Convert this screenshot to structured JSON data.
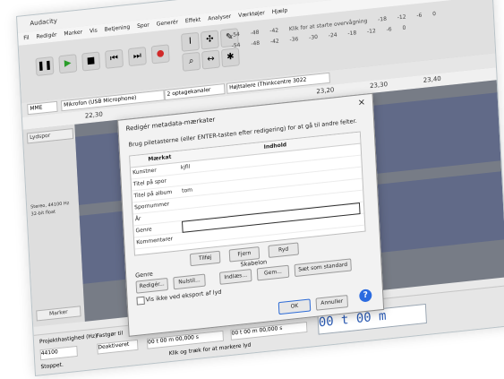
{
  "app": {
    "window_title": "Audacity",
    "menu": [
      "Fil",
      "Redigér",
      "Marker",
      "Vis",
      "Betjening",
      "Spor",
      "Generér",
      "Effekt",
      "Analyser",
      "Værktøjer",
      "Hjælp"
    ],
    "device_bar": {
      "host": "MME",
      "mic": "Mikrofon (USB Microphone)",
      "channels": "2 optagekanaler",
      "speaker": "Højttalere (Thinkcentre 3022"
    },
    "meters": {
      "click_text": "Klik for at starte overvågning",
      "levels": [
        "-54",
        "-48",
        "-42",
        "-18",
        "-12",
        "-6",
        "0"
      ],
      "levels2": [
        "-54",
        "-48",
        "-42",
        "-36",
        "-30",
        "-24",
        "-18",
        "-12",
        "-6",
        "0"
      ]
    },
    "ruler_ticks": [
      "22,30",
      "23,20",
      "23,30",
      "23,40"
    ],
    "track": {
      "label": "Lydspor",
      "info_line1": "Stereo, 44100 Hz",
      "info_line2": "32-bit float",
      "select_label": "Marker"
    },
    "status": {
      "project_rate_label": "Projekthastighed (Hz)",
      "project_rate_value": "44100",
      "snap_label": "Fastgør til",
      "snap_value": "Deaktiveret",
      "selection_label": "Begyndelse og slutning af markering",
      "time1": "00 t 00 m 00,000 s",
      "time2": "00 t 00 m 00,000 s",
      "stopped": "Stoppet.",
      "hint": "Klik og træk for at markere lyd",
      "audio_position": "00 t 00 m"
    }
  },
  "dialog": {
    "title": "Redigér metadata-mærkater",
    "close_label": "×",
    "instruction": "Brug piletasterne (eller ENTER-tasten efter redigering) for at gå til andre felter.",
    "columns": [
      "Mærkat",
      "Indhold"
    ],
    "rows": [
      {
        "tag": "Kunstner",
        "value": "kjfil"
      },
      {
        "tag": "Titel på spor",
        "value": ""
      },
      {
        "tag": "Titel på album",
        "value": "tom"
      },
      {
        "tag": "Spornummer",
        "value": ""
      },
      {
        "tag": "År",
        "value": ""
      },
      {
        "tag": "Genre",
        "value": ""
      },
      {
        "tag": "Kommentarer",
        "value": ""
      }
    ],
    "row_buttons": {
      "add": "Tilføj",
      "remove": "Fjern",
      "clear": "Ryd"
    },
    "genre": {
      "section": "Genre",
      "edit": "Redigér...",
      "reset": "Nulstil..."
    },
    "template": {
      "section": "Skabelon",
      "load": "Indlæs...",
      "save": "Gem...",
      "set_default": "Sæt som standard"
    },
    "checkbox_label": "Vis ikke ved eksport af lyd",
    "ok": "OK",
    "cancel": "Annuller",
    "help": "?"
  },
  "colors": {
    "timebox_text": "#2b5bb5",
    "help_button": "#2b6be0",
    "track_area": "#777c86"
  }
}
